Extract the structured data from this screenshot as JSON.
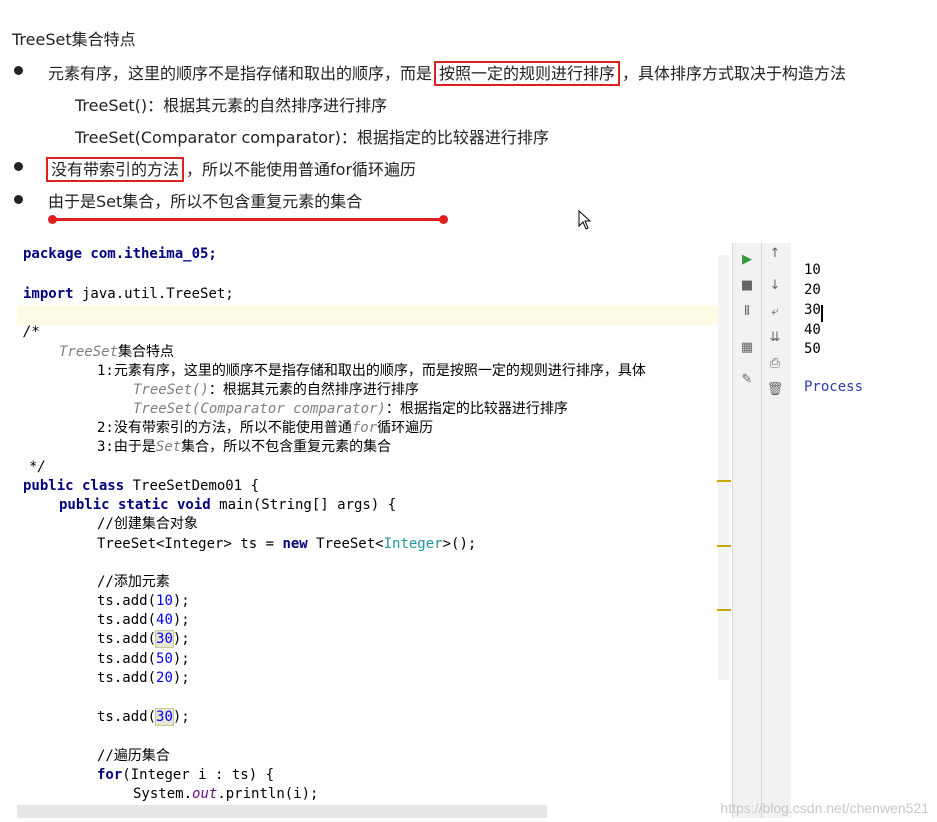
{
  "slide": {
    "title": "TreeSet集合特点",
    "bullet1": {
      "pre": "元素有序，这里的顺序不是指存储和取出的顺序，而是",
      "highlight": "按照一定的规则进行排序",
      "post": "，具体排序方式取决于构造方法"
    },
    "sub1": "TreeSet()：根据其元素的自然排序进行排序",
    "sub2": "TreeSet(Comparator comparator)：根据指定的比较器进行排序",
    "bullet2": {
      "highlight": "没有带索引的方法",
      "post": "，所以不能使用普通for循环遍历"
    },
    "bullet3": "由于是Set集合，所以不包含重复元素的集合",
    "accent_color": "#e02020"
  },
  "code": {
    "package_line": "package com.itheima_05;",
    "import_kw": "import",
    "import_rest": " java.util.TreeSet;",
    "comment_open": "/*",
    "c_title_a": "TreeSet",
    "c_title_b": "集合特点",
    "c1": "1:元素有序，这里的顺序不是指存储和取出的顺序，而是按照一定的规则进行排序，具体",
    "c1a_a": "TreeSet()",
    "c1a_b": "：根据其元素的自然排序进行排序",
    "c1b_a": "TreeSet(Comparator comparator)",
    "c1b_b": "：根据指定的比较器进行排序",
    "c2_a": "2:没有带索引的方法，所以不能使用普通",
    "c2_b": "for",
    "c2_c": "循环遍历",
    "c3_a": "3:由于是",
    "c3_b": "Set",
    "c3_c": "集合，所以不包含重复元素的集合",
    "comment_close": "*/",
    "class_kw": "public class",
    "class_name": " TreeSetDemo01 {",
    "main_kw": "public static void",
    "main_rest": " main(String[] args) {",
    "cm_create": "//创建集合对象",
    "decl_a": "TreeSet<Integer> ts = ",
    "decl_new": "new",
    "decl_b": " TreeSet<",
    "decl_gen": "Integer",
    "decl_c": ">();",
    "cm_add": "//添加元素",
    "add_prefix": "ts.add(",
    "add_suffix": ");",
    "add_values": [
      "10",
      "40",
      "30",
      "50",
      "20"
    ],
    "add_dup": "30",
    "cm_iter": "//遍历集合",
    "for_kw": "for",
    "for_rest": "(Integer i : ts) {",
    "print_a": "System.",
    "print_out": "out",
    "print_b": ".println(i);",
    "close_brace": "}"
  },
  "console": {
    "output": [
      "10",
      "20",
      "30",
      "40",
      "50"
    ],
    "process": "Process"
  },
  "watermark": "https://blog.csdn.net/chenwen521"
}
